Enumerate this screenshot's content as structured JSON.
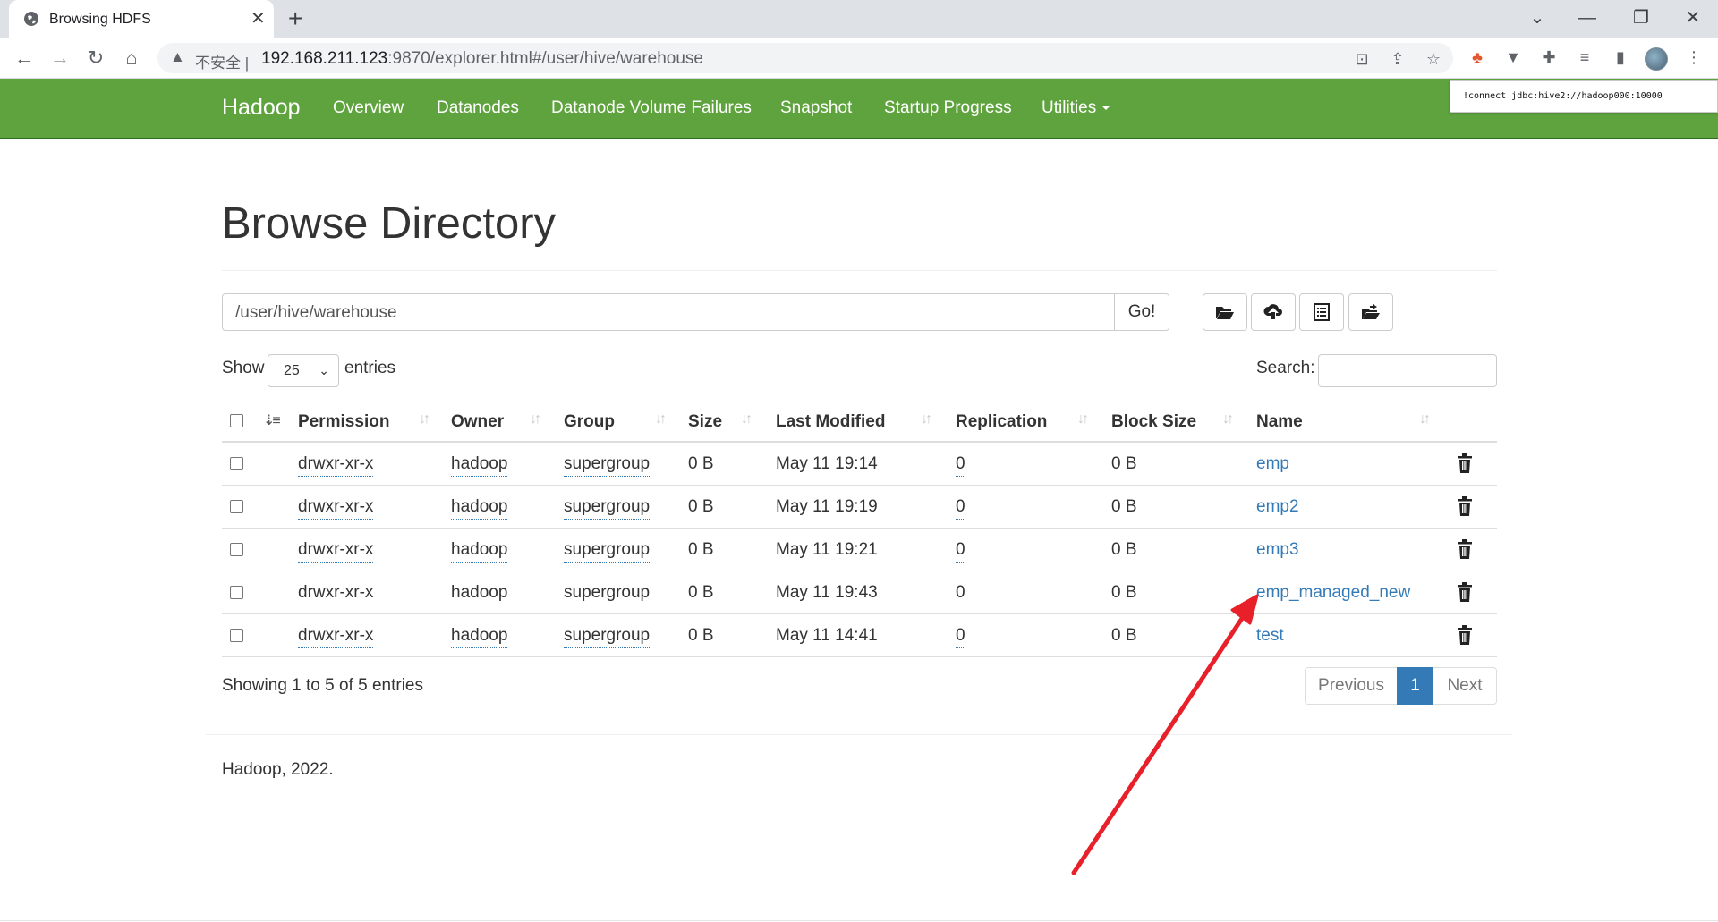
{
  "browser": {
    "tab_title": "Browsing HDFS",
    "tab_close": "✕",
    "new_tab": "+",
    "url_security": "不安全",
    "url_host": "192.168.211.123",
    "url_rest": ":9870/explorer.html#/user/hive/warehouse",
    "window_minimize": "—",
    "window_restore": "❐",
    "window_close": "✕",
    "tab_list": "⌄"
  },
  "navbar": {
    "brand": "Hadoop",
    "items": [
      "Overview",
      "Datanodes",
      "Datanode Volume Failures",
      "Snapshot",
      "Startup Progress",
      "Utilities"
    ]
  },
  "snippet": "!connect jdbc:hive2://hadoop000:10000",
  "page": {
    "title": "Browse Directory",
    "directory_value": "/user/hive/warehouse",
    "go_label": "Go!",
    "show_label": "Show",
    "entries_per_page": "25",
    "entries_label": "entries",
    "search_label": "Search:",
    "search_value": ""
  },
  "table": {
    "columns": [
      "Permission",
      "Owner",
      "Group",
      "Size",
      "Last Modified",
      "Replication",
      "Block Size",
      "Name"
    ],
    "rows": [
      {
        "permission": "drwxr-xr-x",
        "owner": "hadoop",
        "group": "supergroup",
        "size": "0 B",
        "modified": "May 11 19:14",
        "replication": "0",
        "block_size": "0 B",
        "name": "emp"
      },
      {
        "permission": "drwxr-xr-x",
        "owner": "hadoop",
        "group": "supergroup",
        "size": "0 B",
        "modified": "May 11 19:19",
        "replication": "0",
        "block_size": "0 B",
        "name": "emp2"
      },
      {
        "permission": "drwxr-xr-x",
        "owner": "hadoop",
        "group": "supergroup",
        "size": "0 B",
        "modified": "May 11 19:21",
        "replication": "0",
        "block_size": "0 B",
        "name": "emp3"
      },
      {
        "permission": "drwxr-xr-x",
        "owner": "hadoop",
        "group": "supergroup",
        "size": "0 B",
        "modified": "May 11 19:43",
        "replication": "0",
        "block_size": "0 B",
        "name": "emp_managed_new"
      },
      {
        "permission": "drwxr-xr-x",
        "owner": "hadoop",
        "group": "supergroup",
        "size": "0 B",
        "modified": "May 11 14:41",
        "replication": "0",
        "block_size": "0 B",
        "name": "test"
      }
    ]
  },
  "pagination": {
    "summary": "Showing 1 to 5 of 5 entries",
    "previous": "Previous",
    "current": "1",
    "next": "Next"
  },
  "footer": "Hadoop, 2022.",
  "colors": {
    "navbar": "#5fa33e",
    "link": "#337ab7",
    "annotation_arrow": "#e8202a"
  },
  "icons": [
    "globe-icon",
    "back-icon",
    "forward-icon",
    "reload-icon",
    "home-icon",
    "warning-icon",
    "translate-icon",
    "share-icon",
    "star-icon",
    "extensions-icon",
    "folder-open-icon",
    "upload-icon",
    "list-icon",
    "move-icon",
    "trash-icon",
    "sort-icon"
  ]
}
